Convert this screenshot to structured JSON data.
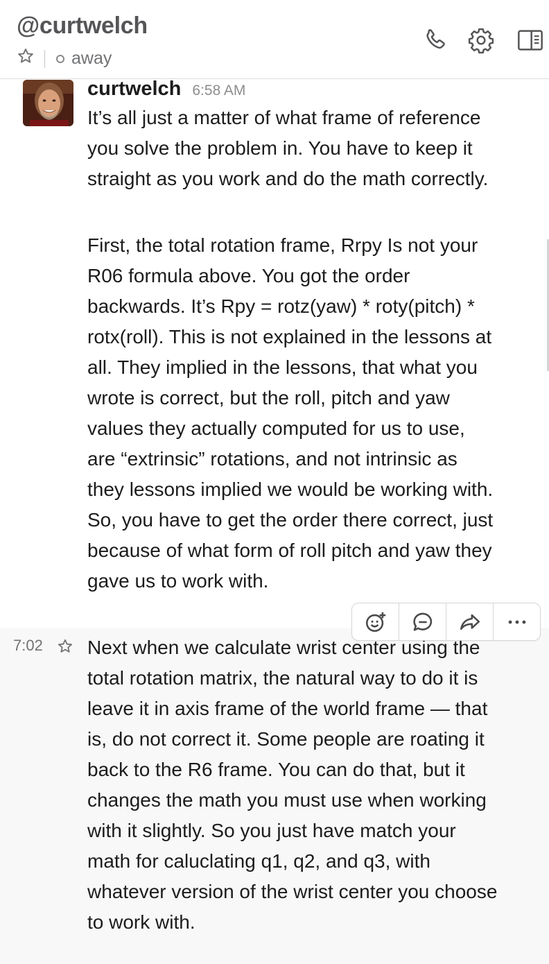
{
  "header": {
    "channel_name": "@curtwelch",
    "presence": "away",
    "icons": [
      "star-icon",
      "phone-icon",
      "gear-icon",
      "sidebar-panel-icon"
    ]
  },
  "messages": [
    {
      "author": "curtwelch",
      "time": "6:58 AM",
      "paragraphs": [
        "It’s all just a matter of what frame of reference you solve the problem in.  You have to keep it straight as you work and do the math correctly.",
        "First, the total rotation frame, Rrpy Is not your R06 formula above.  You got the order backwards.  It’s Rpy = rotz(yaw) * roty(pitch) * rotx(roll).  This is not explained in the lessons at all.  They implied in the lessons, that what you wrote is correct, but the roll, pitch and yaw values they actually computed for us to use, are “extrinsic” rotations, and not intrinsic as they lessons implied we would be working with.  So, you have to get the order there correct, just because of what form of roll pitch and yaw they gave us to work with."
      ]
    },
    {
      "time": "7:02",
      "text": "Next when we calculate wrist center using the total rotation matrix, the natural way to do it is leave it in axis frame of the world frame — that is, do not correct it.  Some people are roating it back to the R6 frame.  You can do that, but it changes the math you must use when working with it slightly.  So you just have match your math for caluclating q1, q2, and q3, with whatever version of the wrist center you choose to work with."
    }
  ],
  "message_actions": [
    "add-reaction-icon",
    "reply-thread-icon",
    "share-icon",
    "more-actions-icon"
  ],
  "colors": {
    "text": "#1d1c1d",
    "muted": "#717274",
    "hover_bg": "#f8f8f8"
  }
}
